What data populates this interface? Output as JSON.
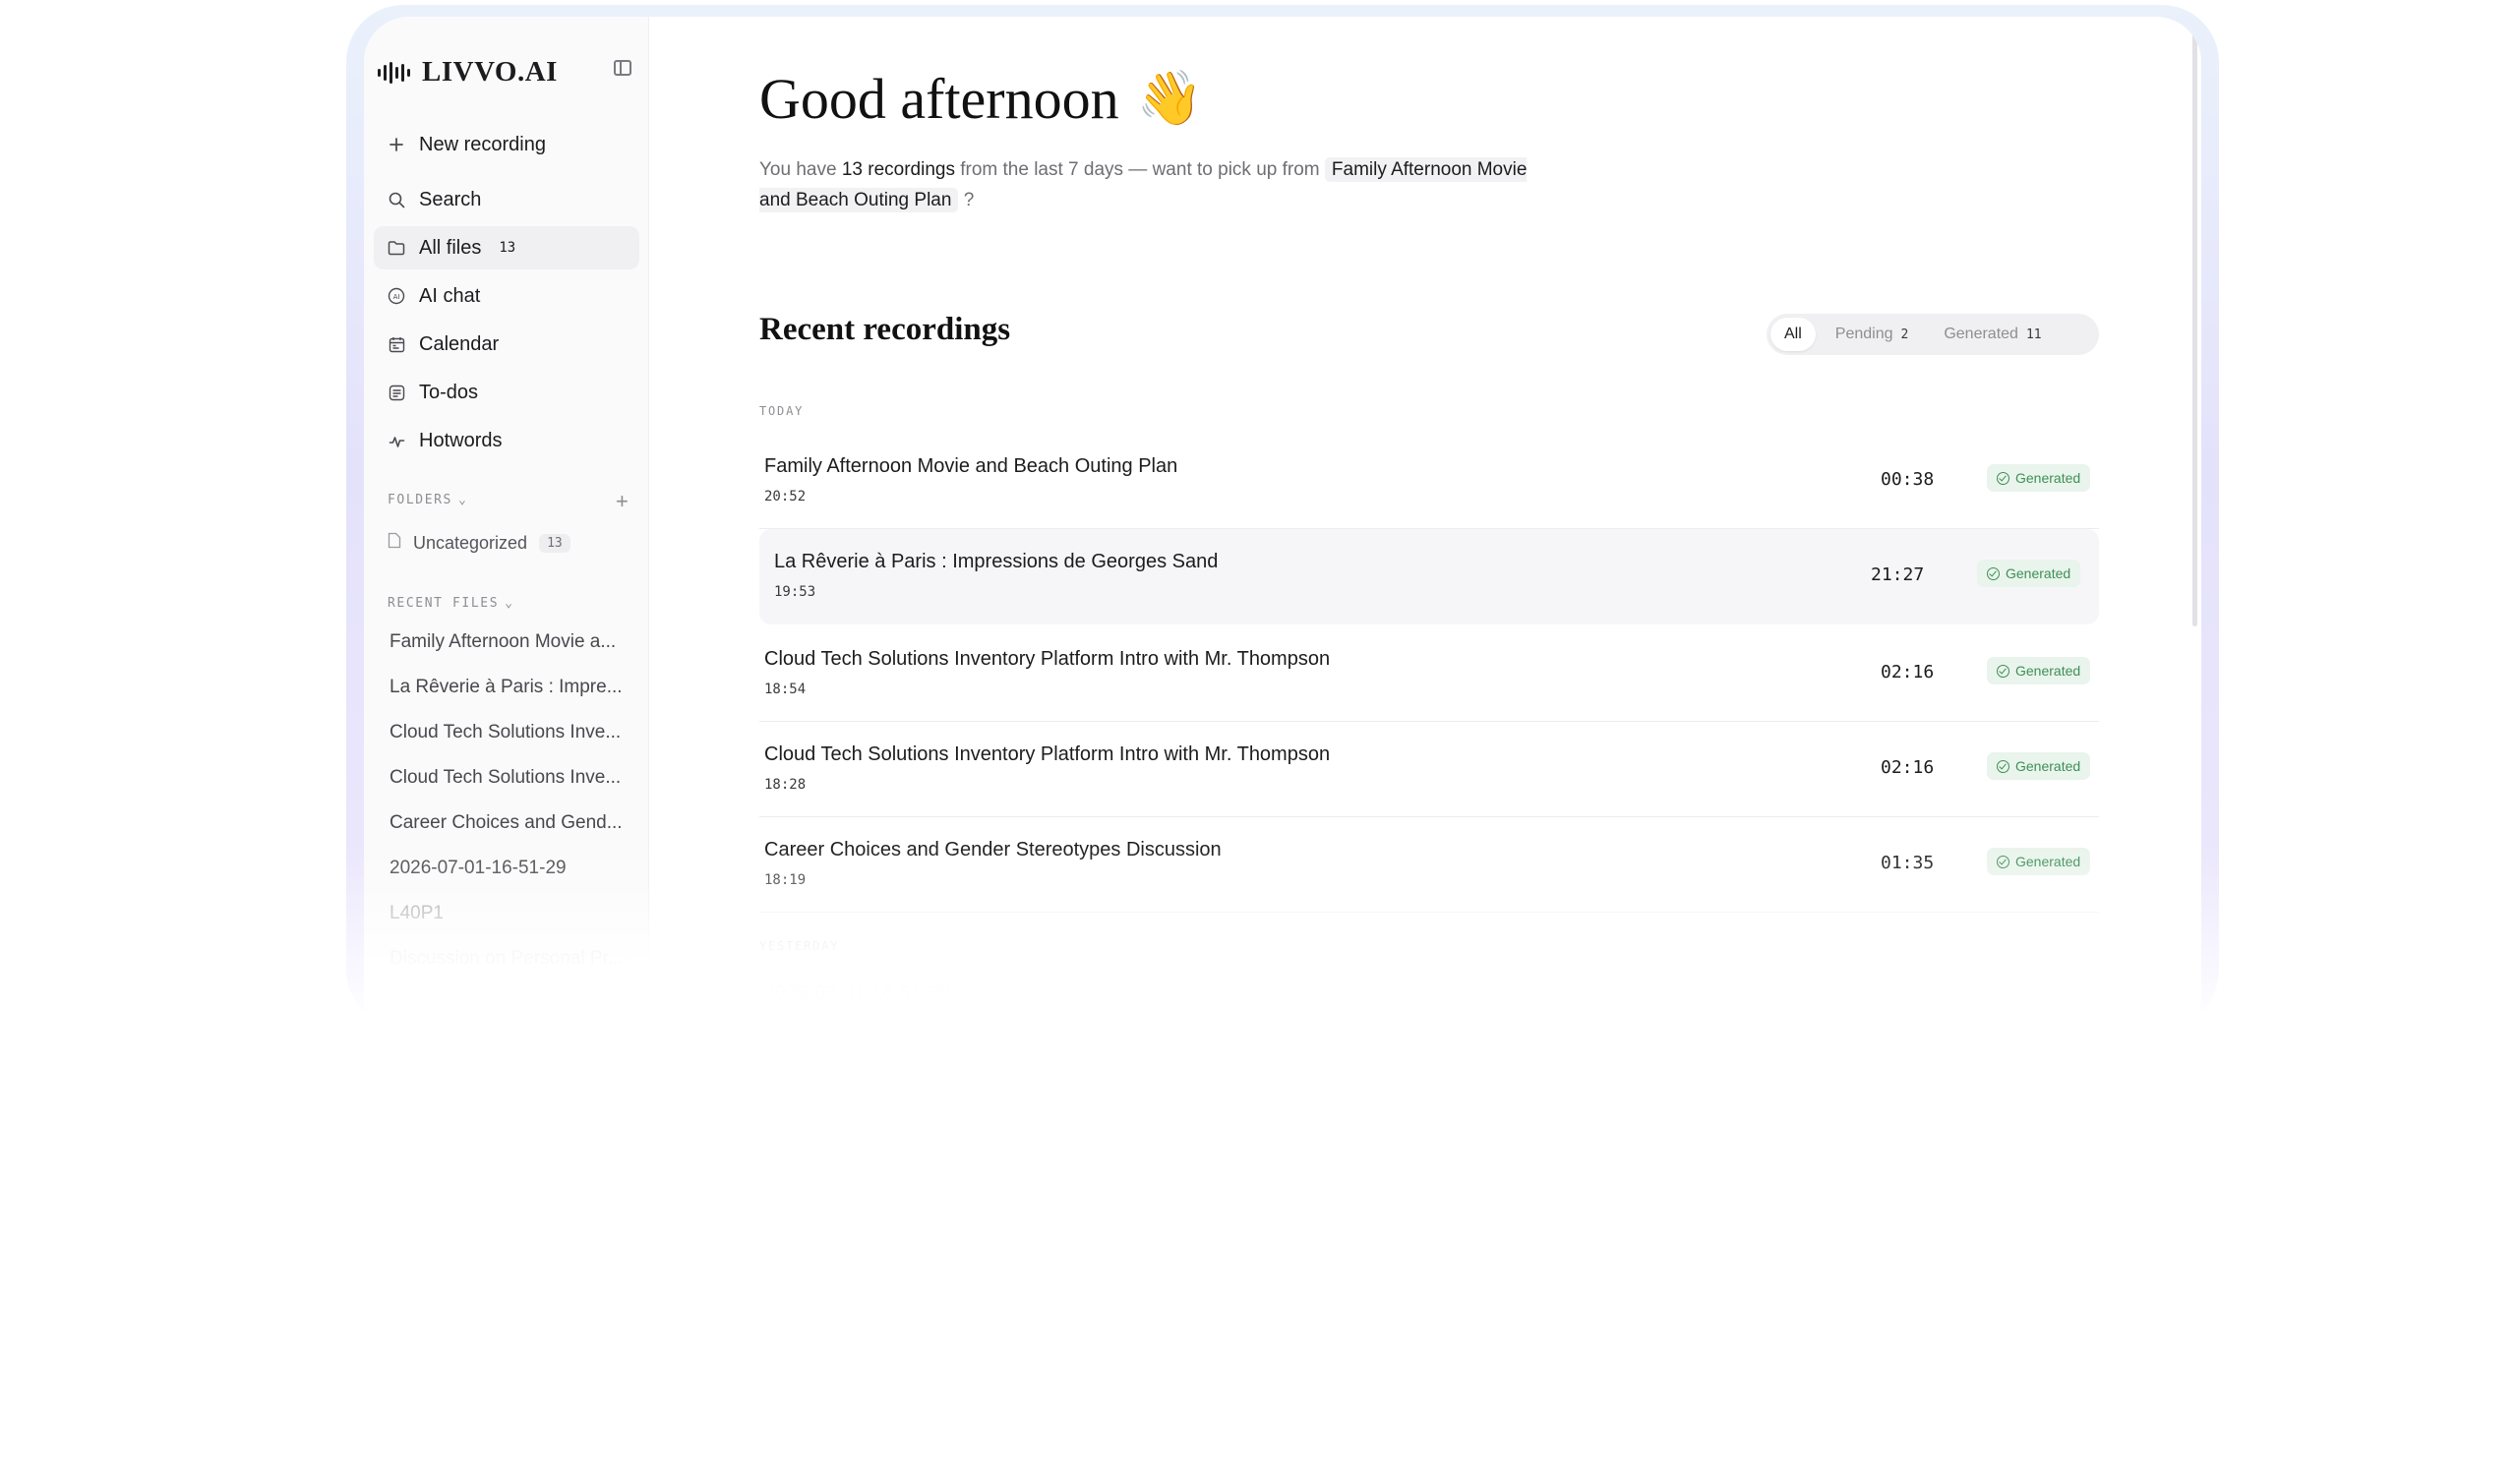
{
  "app": {
    "logo_text": "LIVVO.AI"
  },
  "sidebar": {
    "new_recording": "New recording",
    "nav": [
      {
        "label": "Search",
        "icon": "search-icon"
      },
      {
        "label": "All files",
        "icon": "folder-icon",
        "count": "13"
      },
      {
        "label": "AI chat",
        "icon": "ai-chat-icon"
      },
      {
        "label": "Calendar",
        "icon": "calendar-icon"
      },
      {
        "label": "To-dos",
        "icon": "todo-icon"
      },
      {
        "label": "Hotwords",
        "icon": "hotwords-icon"
      }
    ],
    "folders_header": "FOLDERS",
    "folders": [
      {
        "label": "Uncategorized",
        "count": "13"
      }
    ],
    "recent_header": "RECENT FILES",
    "recent_files": [
      "Family Afternoon Movie a...",
      "La Rêverie à Paris : Impre...",
      "Cloud Tech Solutions Inve...",
      "Cloud Tech Solutions Inve...",
      "Career Choices and Gend...",
      "2026-07-01-16-51-29",
      "L40P1",
      "Discussion on Personal Pr..."
    ]
  },
  "main": {
    "greeting": "Good afternoon",
    "greeting_emoji": "👋",
    "sub_prefix": "You have",
    "sub_count": "13 recordings",
    "sub_middle": "from the last 7 days — want to pick up from",
    "sub_link": "Family Afternoon Movie and Beach Outing Plan",
    "sub_suffix": "?",
    "recent_title": "Recent recordings",
    "filters": [
      {
        "label": "All",
        "count": ""
      },
      {
        "label": "Pending",
        "count": "2"
      },
      {
        "label": "Generated",
        "count": "11"
      }
    ],
    "today_label": "TODAY",
    "yesterday_label": "YESTERDAY",
    "recordings": [
      {
        "title": "Family Afternoon Movie and Beach Outing Plan",
        "time": "20:52",
        "duration": "00:38",
        "status": "Generated"
      },
      {
        "title": "La Rêverie à Paris : Impressions de Georges Sand",
        "time": "19:53",
        "duration": "21:27",
        "status": "Generated"
      },
      {
        "title": "Cloud Tech Solutions Inventory Platform Intro with Mr. Thompson",
        "time": "18:54",
        "duration": "02:16",
        "status": "Generated"
      },
      {
        "title": "Cloud Tech Solutions Inventory Platform Intro with Mr. Thompson",
        "time": "18:28",
        "duration": "02:16",
        "status": "Generated"
      },
      {
        "title": "Career Choices and Gender Stereotypes Discussion",
        "time": "18:19",
        "duration": "01:35",
        "status": "Generated"
      }
    ],
    "faded_row": "2026-07-01-16-51-29"
  },
  "colors": {
    "accent_generated": "#3f8f56",
    "generated_bg": "#e9f4ec",
    "frame_glow": "#e4e2fb"
  }
}
